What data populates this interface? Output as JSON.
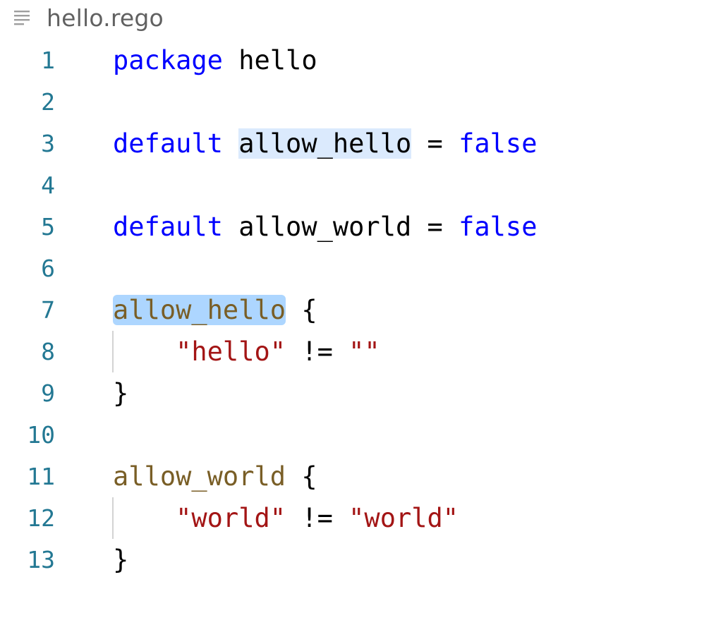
{
  "breadcrumb": {
    "icon": "lines-icon",
    "file_name": "hello.rego"
  },
  "colors": {
    "keyword": "#0000ff",
    "function": "#795e26",
    "string": "#a31515",
    "line_number": "#237893",
    "highlight_soft": "#dbeafd",
    "highlight_strong": "#add6ff"
  },
  "lines": [
    {
      "number": "1",
      "tokens": [
        {
          "t": "package",
          "c": "kw"
        },
        {
          "t": " "
        },
        {
          "t": "hello"
        }
      ]
    },
    {
      "number": "2",
      "tokens": []
    },
    {
      "number": "3",
      "tokens": [
        {
          "t": "default",
          "c": "kw"
        },
        {
          "t": " "
        },
        {
          "t": "allow_hello",
          "hl": "soft"
        },
        {
          "t": " = "
        },
        {
          "t": "false",
          "c": "kw"
        }
      ]
    },
    {
      "number": "4",
      "tokens": []
    },
    {
      "number": "5",
      "tokens": [
        {
          "t": "default",
          "c": "kw"
        },
        {
          "t": " "
        },
        {
          "t": "allow_world"
        },
        {
          "t": " = "
        },
        {
          "t": "false",
          "c": "kw"
        }
      ]
    },
    {
      "number": "6",
      "tokens": []
    },
    {
      "number": "7",
      "tokens": [
        {
          "t": "allow_hello",
          "c": "fn",
          "hl": "strong"
        },
        {
          "t": " {"
        }
      ]
    },
    {
      "number": "8",
      "indent": true,
      "tokens": [
        {
          "t": "    "
        },
        {
          "t": "\"hello\"",
          "c": "str"
        },
        {
          "t": " != "
        },
        {
          "t": "\"\"",
          "c": "str"
        }
      ]
    },
    {
      "number": "9",
      "tokens": [
        {
          "t": "}"
        }
      ]
    },
    {
      "number": "10",
      "tokens": []
    },
    {
      "number": "11",
      "tokens": [
        {
          "t": "allow_world",
          "c": "fn"
        },
        {
          "t": " {"
        }
      ]
    },
    {
      "number": "12",
      "indent": true,
      "tokens": [
        {
          "t": "    "
        },
        {
          "t": "\"world\"",
          "c": "str"
        },
        {
          "t": " != "
        },
        {
          "t": "\"world\"",
          "c": "str"
        }
      ]
    },
    {
      "number": "13",
      "tokens": [
        {
          "t": "}"
        }
      ]
    }
  ]
}
